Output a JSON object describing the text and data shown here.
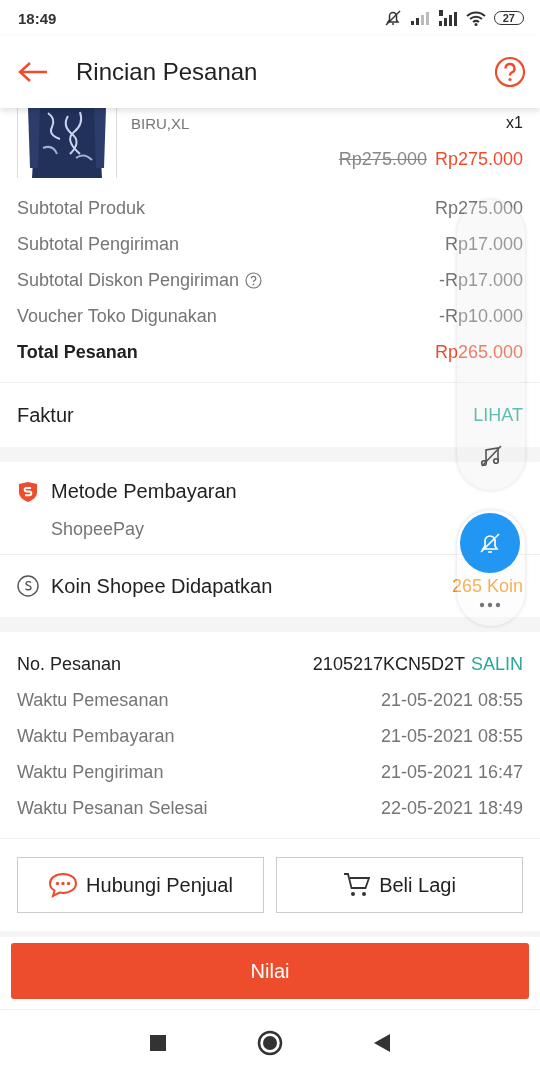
{
  "status_bar": {
    "time": "18:49",
    "battery": "27"
  },
  "header": {
    "title": "Rincian Pesanan"
  },
  "product": {
    "kind": "picture",
    "variant": "BIRU,XL",
    "quantity": "x1",
    "original_price": "Rp275.000",
    "price": "Rp275.000"
  },
  "summary": [
    {
      "label": "Subtotal Produk",
      "value": "Rp275.000",
      "kind": "plain"
    },
    {
      "label": "Subtotal Pengiriman",
      "value": "Rp17.000",
      "kind": "plain"
    },
    {
      "label": "Subtotal Diskon Pengiriman",
      "value": "-Rp17.000",
      "kind": "help"
    },
    {
      "label": "Voucher Toko Digunakan",
      "value": "-Rp10.000",
      "kind": "plain"
    },
    {
      "label": "Total Pesanan",
      "value": "Rp265.000",
      "kind": "total"
    }
  ],
  "invoice": {
    "label": "Faktur",
    "action": "LIHAT"
  },
  "payment": {
    "title": "Metode Pembayaran",
    "method": "ShopeePay"
  },
  "coins": {
    "label": "Koin Shopee Didapatkan",
    "value": "265 Koin"
  },
  "order": {
    "number_label": "No. Pesanan",
    "number": "2105217KCN5D2T",
    "copy": "SALIN",
    "times": [
      {
        "label": "Waktu Pemesanan",
        "value": "21-05-2021 08:55"
      },
      {
        "label": "Waktu Pembayaran",
        "value": "21-05-2021 08:55"
      },
      {
        "label": "Waktu Pengiriman",
        "value": "21-05-2021 16:47"
      },
      {
        "label": "Waktu Pesanan Selesai",
        "value": "22-05-2021 18:49"
      }
    ]
  },
  "actions": [
    {
      "label": "Hubungi Penjual",
      "kind": "chat"
    },
    {
      "label": "Beli Lagi",
      "kind": "cart"
    }
  ],
  "primary_button": "Nilai"
}
